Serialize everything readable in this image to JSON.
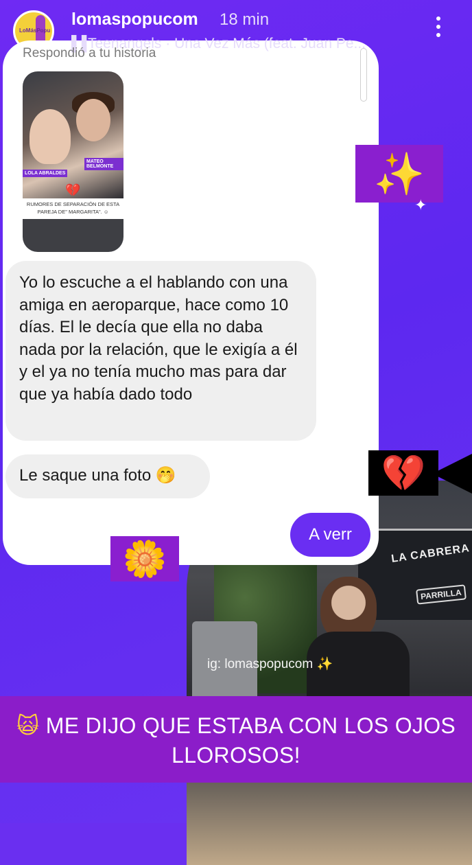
{
  "header": {
    "username": "lomaspopucom",
    "time": "18 min",
    "music_icon": "audio-bars-icon",
    "music": "Teenangels · Una Vez Más (feat. Juan Pe...",
    "avatar_text": "LoMásPopu",
    "more_icon": "vertical-dots-icon"
  },
  "reply": {
    "label": "Respondió a tu historia",
    "story": {
      "label_left": "LOLA ABRALDES",
      "label_right": "MATEO BELMONTE",
      "caption": "RUMORES DE SEPARACIÓN DE ESTA PAREJA DE\" MARGARITA\". ☺"
    }
  },
  "messages": [
    "Yo lo escuche a el hablando con una amiga en aeroparque, hace como 10 días.  El le decía que ella no daba nada por la relación, que le exigía a él y el ya no tenía mucho mas para dar que ya había dado todo",
    "Le saque una foto 🤭"
  ],
  "sent": {
    "text": "A verr"
  },
  "stickers": {
    "sparkles": "✨",
    "broken_heart": "💔",
    "flower": "🌼"
  },
  "photo": {
    "watermark": "ig: lomaspopucom ✨",
    "sign1": "LA CABRERA",
    "sign2": "PARRILLA"
  },
  "banner": {
    "emoji": "🙀",
    "text": "ME DIJO QUE ESTABA CON LOS OJOS LLOROSOS!"
  },
  "colors": {
    "background": "#6a2ff0",
    "sent_bubble": "#6a2ef2",
    "banner": "#8b1dc9"
  }
}
